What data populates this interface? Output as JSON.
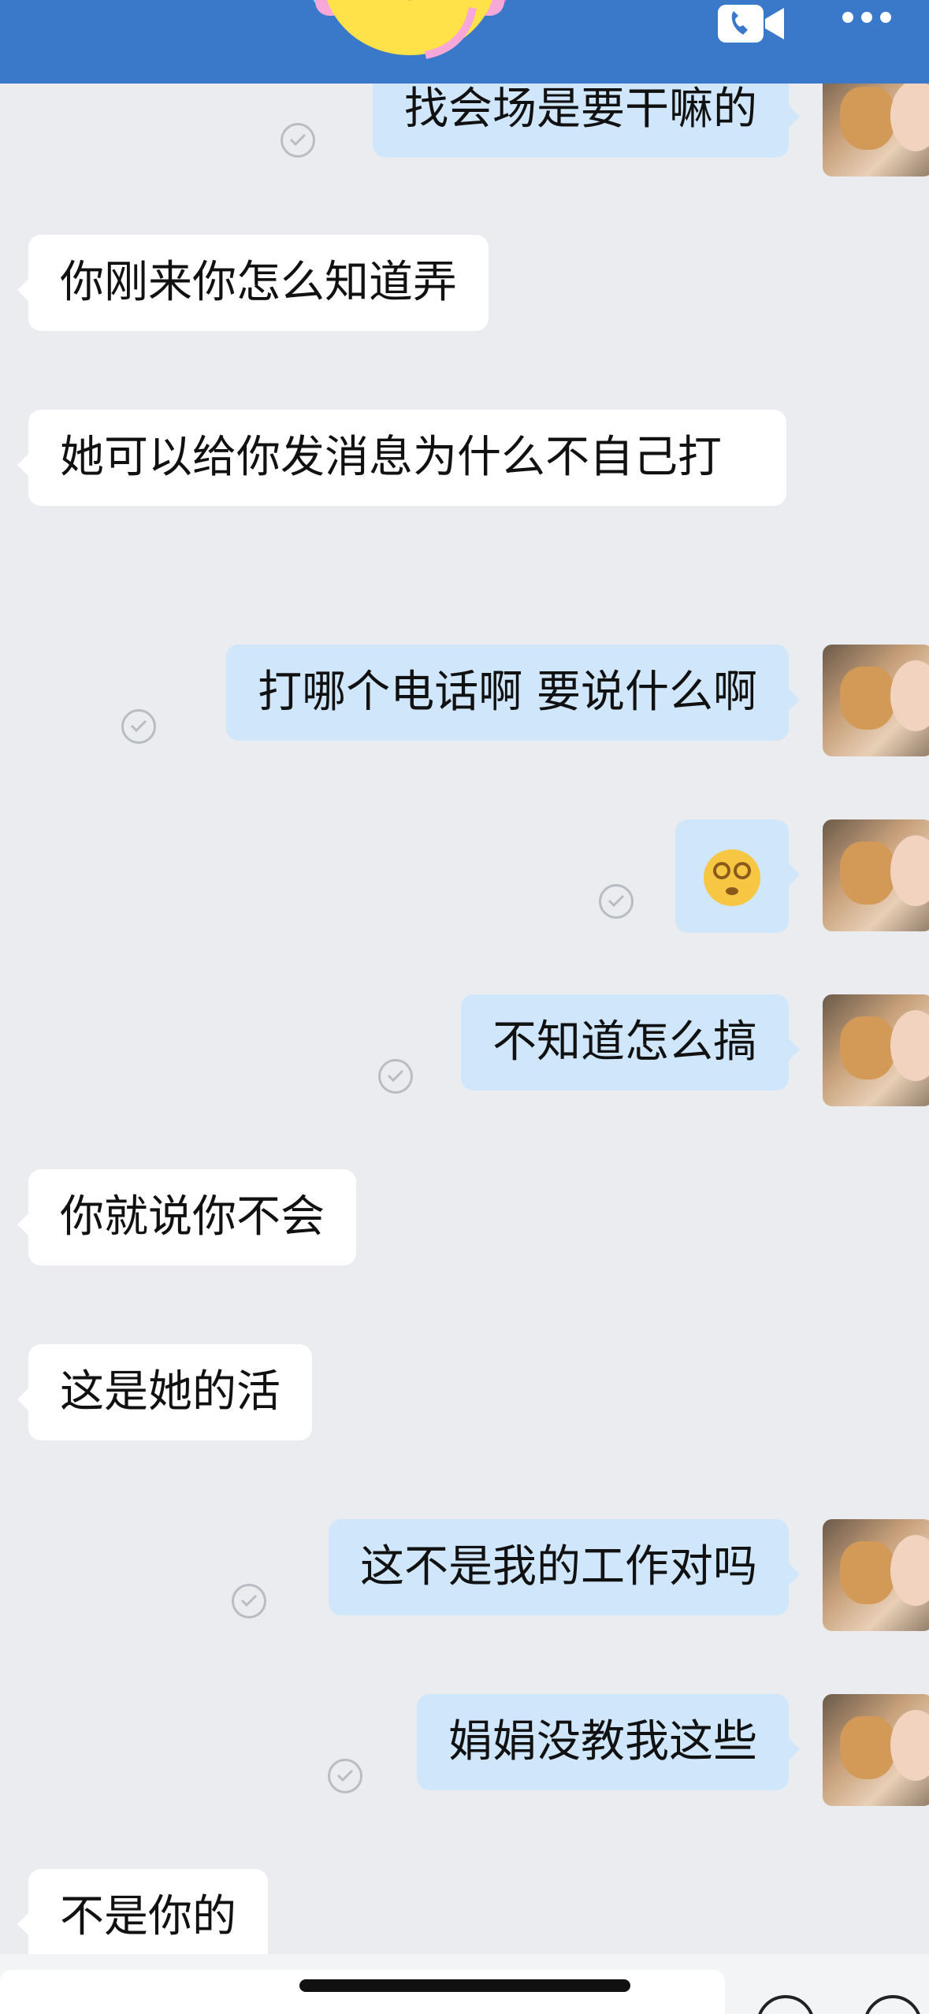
{
  "header": {
    "title": "",
    "call_icon": "video-call-icon",
    "more_icon": "more-icon"
  },
  "messages": [
    {
      "side": "out",
      "text": "找会场是要干嘛的",
      "status_icon": "sent-check-icon"
    },
    {
      "side": "in",
      "text": "你刚来你怎么知道弄"
    },
    {
      "side": "in",
      "text": "她可以给你发消息为什么不自己打"
    },
    {
      "side": "out",
      "text": "打哪个电话啊 要说什么啊",
      "status_icon": "sent-check-icon"
    },
    {
      "side": "out",
      "text": "",
      "emoji": "dizzy-face-emoji",
      "status_icon": "sent-check-icon"
    },
    {
      "side": "out",
      "text": "不知道怎么搞",
      "status_icon": "sent-check-icon"
    },
    {
      "side": "in",
      "text": "你就说你不会"
    },
    {
      "side": "in",
      "text": "这是她的活"
    },
    {
      "side": "out",
      "text": "这不是我的工作对吗",
      "status_icon": "sent-check-icon"
    },
    {
      "side": "out",
      "text": "娟娟没教我这些",
      "status_icon": "sent-check-icon"
    },
    {
      "side": "in",
      "text": "不是你的"
    }
  ],
  "colors": {
    "header": "#3a78c9",
    "background": "#eaecef",
    "incoming_bubble": "#ffffff",
    "outgoing_bubble": "#cfe6fb"
  }
}
